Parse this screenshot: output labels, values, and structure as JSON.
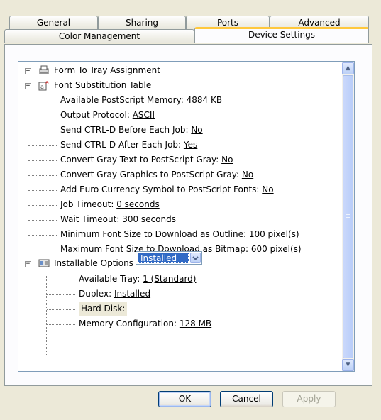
{
  "tabs": {
    "row_back": [
      "General",
      "Sharing",
      "Ports",
      "Advanced"
    ],
    "row_front": [
      "Color Management",
      "Device Settings"
    ],
    "active": "Device Settings"
  },
  "tree": {
    "items": [
      {
        "label": "Form To Tray Assignment",
        "value": ""
      },
      {
        "label": "Font Substitution Table",
        "value": ""
      },
      {
        "label": "Available PostScript Memory: ",
        "value": "4884 KB"
      },
      {
        "label": "Output Protocol: ",
        "value": "ASCII"
      },
      {
        "label": "Send CTRL-D Before Each Job: ",
        "value": "No"
      },
      {
        "label": "Send CTRL-D After Each Job: ",
        "value": "Yes"
      },
      {
        "label": "Convert Gray Text to PostScript Gray: ",
        "value": "No"
      },
      {
        "label": "Convert Gray Graphics to PostScript Gray: ",
        "value": "No"
      },
      {
        "label": "Add Euro Currency Symbol to PostScript Fonts: ",
        "value": "No"
      },
      {
        "label": "Job Timeout: ",
        "value": "0 seconds"
      },
      {
        "label": "Wait Timeout: ",
        "value": "300 seconds"
      },
      {
        "label": "Minimum Font Size to Download as Outline: ",
        "value": "100 pixel(s)"
      },
      {
        "label": "Maximum Font Size to Download as Bitmap: ",
        "value": "600 pixel(s)"
      },
      {
        "label": "Installable Options",
        "value": ""
      },
      {
        "label": "Available Tray: ",
        "value": "1 (Standard)"
      },
      {
        "label": "Duplex: ",
        "value": "Installed"
      },
      {
        "label": "Hard Disk:",
        "value": ""
      },
      {
        "label": "Memory Configuration: ",
        "value": "128 MB"
      }
    ],
    "expander_plus": "+",
    "expander_minus": "−",
    "hard_disk_select": "Installed"
  },
  "buttons": {
    "ok": "OK",
    "cancel": "Cancel",
    "apply": "Apply"
  },
  "colors": {
    "accent_tab": "#ffc83c",
    "selection": "#316ac5",
    "dialog_bg": "#ece9d8"
  }
}
